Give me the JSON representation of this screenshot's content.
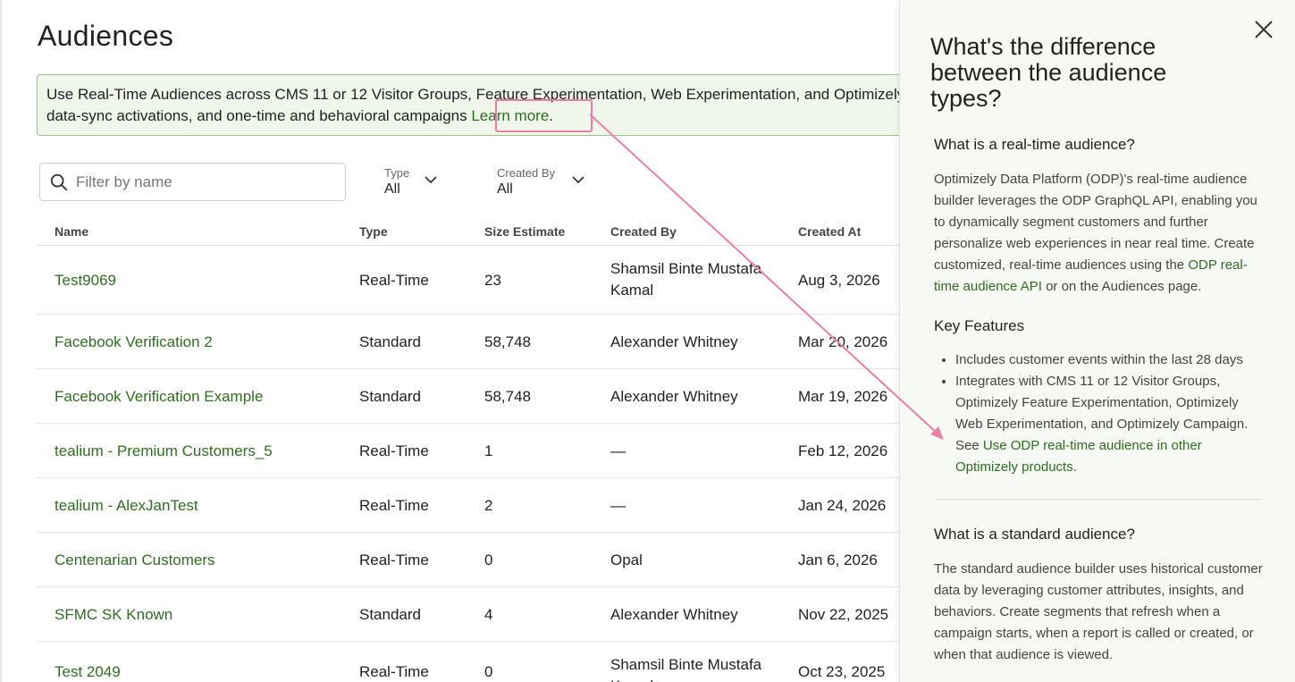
{
  "page": {
    "title": "Audiences"
  },
  "banner": {
    "line1": "Use Real-Time Audiences across CMS 11 or 12 Visitor Groups, Feature Experimentation, Web Experimentation, and Optimizely Campaign, as well as",
    "line2": "data-sync activations, and one-time and behavioral campaigns",
    "learn_more": "Learn more",
    "period": "."
  },
  "search": {
    "placeholder": "Filter by name"
  },
  "filters": {
    "type_label": "Type",
    "type_value": "All",
    "created_by_label": "Created By",
    "created_by_value": "All"
  },
  "table": {
    "columns": [
      "Name",
      "Type",
      "Size Estimate",
      "Created By",
      "Created At"
    ],
    "rows": [
      {
        "name": "Test9069",
        "type": "Real-Time",
        "size": "23",
        "created_by": "Shamsil Binte Mustafa Kamal",
        "created_at": "Aug 3, 2026"
      },
      {
        "name": "Facebook Verification 2",
        "type": "Standard",
        "size": "58,748",
        "created_by": "Alexander Whitney",
        "created_at": "Mar 20, 2026"
      },
      {
        "name": "Facebook Verification Example",
        "type": "Standard",
        "size": "58,748",
        "created_by": "Alexander Whitney",
        "created_at": "Mar 19, 2026"
      },
      {
        "name": "tealium - Premium Customers_5",
        "type": "Real-Time",
        "size": "1",
        "created_by": "—",
        "created_at": "Feb 12, 2026"
      },
      {
        "name": "tealium - AlexJanTest",
        "type": "Real-Time",
        "size": "2",
        "created_by": "—",
        "created_at": "Jan 24, 2026"
      },
      {
        "name": "Centenarian Customers",
        "type": "Real-Time",
        "size": "0",
        "created_by": "Opal",
        "created_at": "Jan 6, 2026"
      },
      {
        "name": "SFMC SK Known",
        "type": "Standard",
        "size": "4",
        "created_by": "Alexander Whitney",
        "created_at": "Nov 22, 2025"
      },
      {
        "name": "Test 2049",
        "type": "Real-Time",
        "size": "0",
        "created_by": "Shamsil Binte Mustafa Kamal",
        "created_at": "Oct 23, 2025"
      }
    ]
  },
  "panel": {
    "title": "What's the difference between the audience types?",
    "rt_heading": "What is a real-time audience?",
    "rt_text_1": "Optimizely Data Platform (ODP)'s real-time audience builder leverages the ODP GraphQL API, enabling you to dynamically segment customers and further personalize web experiences in near real time. Create customized, real-time audiences using the ",
    "rt_link": "ODP real-time audience API",
    "rt_text_2": " or on the Audiences page.",
    "kf_heading": "Key Features",
    "kf_item1": "Includes customer events within the last 28 days",
    "kf_item2_text": "Integrates with CMS 11 or 12 Visitor Groups, Optimizely Feature Experimentation, Optimizely Web Experimentation, and Optimizely Campaign. See ",
    "kf_item2_link": "Use ODP real-time audience in other Optimizely products",
    "kf_item2_end": ".",
    "std_heading": "What is a standard audience?",
    "std_text": "The standard audience builder uses historical customer data by leveraging customer attributes, insights, and behaviors. Create segments that refresh when a campaign starts, when a report is called or created, or when that audience is viewed."
  },
  "colors": {
    "accent_green": "#2e6e20",
    "banner_bg": "#f0f6ea",
    "annotation_pink": "#e87fa6"
  }
}
